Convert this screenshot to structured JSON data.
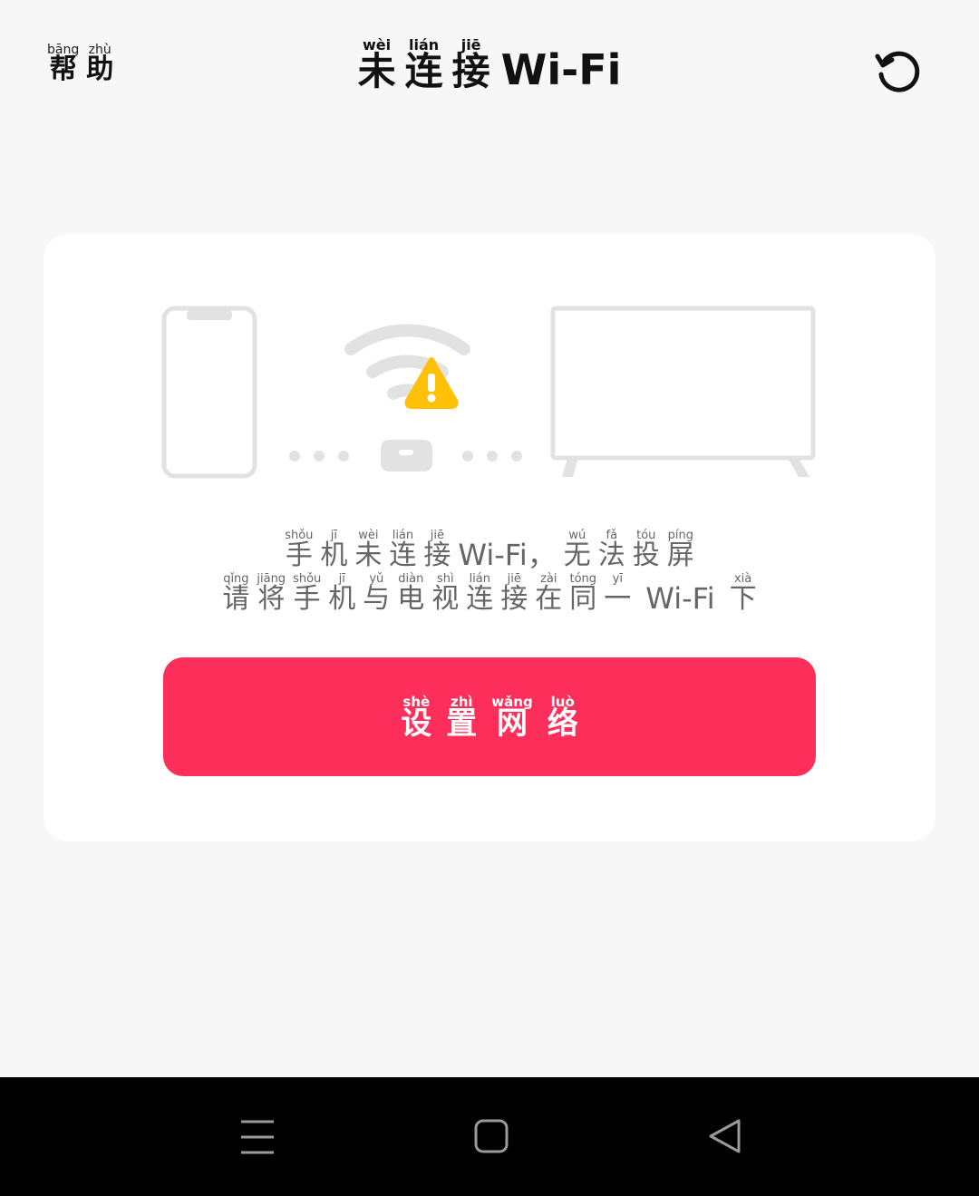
{
  "header": {
    "help": {
      "chars": [
        {
          "hz": "帮",
          "py": "bāng"
        },
        {
          "hz": "助",
          "py": "zhù"
        }
      ]
    },
    "title": {
      "chars": [
        {
          "hz": "未",
          "py": "wèi"
        },
        {
          "hz": "连",
          "py": "lián"
        },
        {
          "hz": "接",
          "py": "jiē"
        }
      ],
      "suffix": "Wi-Fi"
    },
    "refresh_icon": "refresh-icon"
  },
  "card": {
    "illustration_icons": [
      "phone-icon",
      "wifi-icon",
      "warning-icon",
      "router-icon",
      "tv-icon"
    ],
    "warning_color": "#ffc107",
    "message_line1": {
      "part1": [
        {
          "hz": "手",
          "py": "shǒu"
        },
        {
          "hz": "机",
          "py": "jī"
        },
        {
          "hz": "未",
          "py": "wèi"
        },
        {
          "hz": "连",
          "py": "lián"
        },
        {
          "hz": "接",
          "py": "jiē"
        }
      ],
      "latin": "Wi-Fi，",
      "part2": [
        {
          "hz": "无",
          "py": "wú"
        },
        {
          "hz": "法",
          "py": "fǎ"
        },
        {
          "hz": "投",
          "py": "tóu"
        },
        {
          "hz": "屏",
          "py": "píng"
        }
      ]
    },
    "message_line2": {
      "part1": [
        {
          "hz": "请",
          "py": "qǐng"
        },
        {
          "hz": "将",
          "py": "jiāng"
        },
        {
          "hz": "手",
          "py": "shǒu"
        },
        {
          "hz": "机",
          "py": "jī"
        },
        {
          "hz": "与",
          "py": "yǔ"
        },
        {
          "hz": "电",
          "py": "diàn"
        },
        {
          "hz": "视",
          "py": "shì"
        },
        {
          "hz": "连",
          "py": "lián"
        },
        {
          "hz": "接",
          "py": "jiē"
        },
        {
          "hz": "在",
          "py": "zài"
        },
        {
          "hz": "同",
          "py": "tóng"
        },
        {
          "hz": "一",
          "py": "yī"
        }
      ],
      "latin": "Wi-Fi",
      "part2": [
        {
          "hz": "下",
          "py": "xià"
        }
      ]
    },
    "setup_button": {
      "chars": [
        {
          "hz": "设",
          "py": "shè"
        },
        {
          "hz": "置",
          "py": "zhì"
        },
        {
          "hz": "网",
          "py": "wǎng"
        },
        {
          "hz": "络",
          "py": "luò"
        }
      ],
      "color": "#fd2f5a"
    }
  },
  "navbar": {
    "icons": [
      "menu-icon",
      "home-icon",
      "back-icon"
    ]
  }
}
